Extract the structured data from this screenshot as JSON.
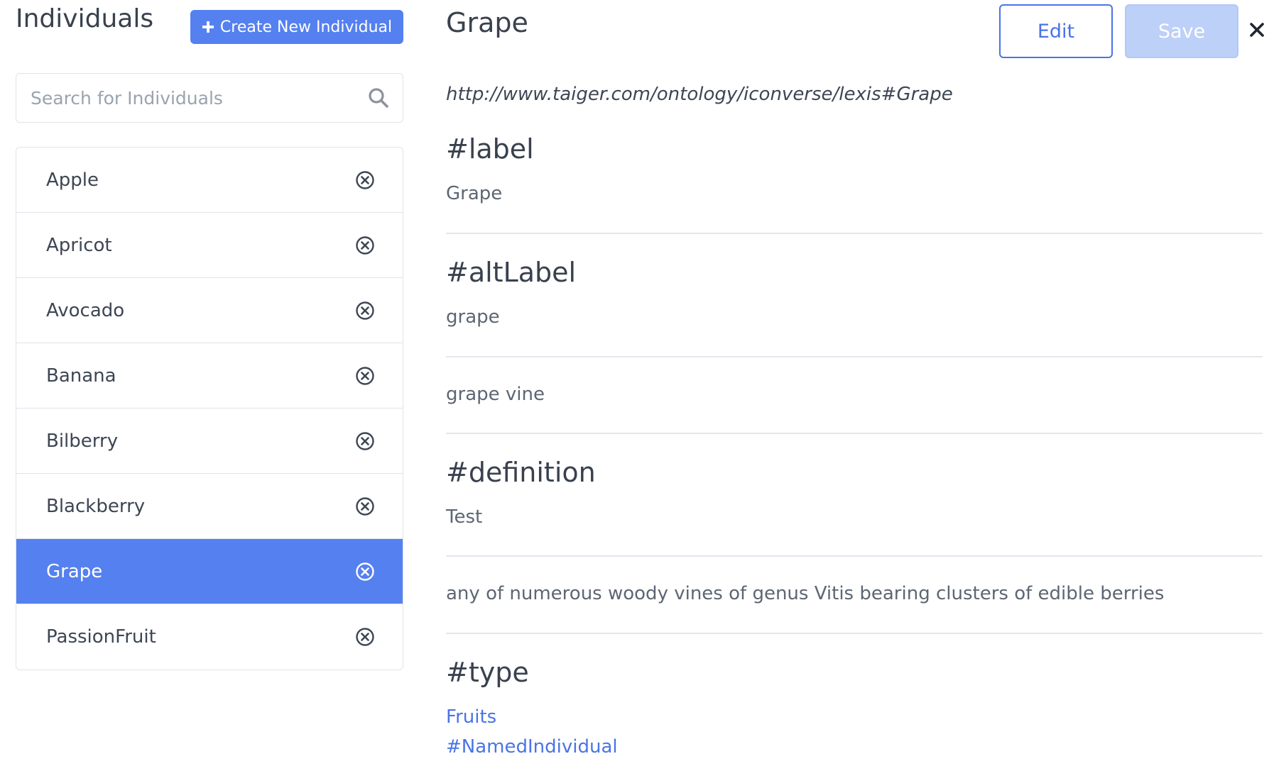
{
  "sidebar": {
    "title": "Individuals",
    "create_button": "Create New Individual",
    "search_placeholder": "Search for Individuals",
    "items": [
      {
        "label": "Apple",
        "selected": false
      },
      {
        "label": "Apricot",
        "selected": false
      },
      {
        "label": "Avocado",
        "selected": false
      },
      {
        "label": "Banana",
        "selected": false
      },
      {
        "label": "Bilberry",
        "selected": false
      },
      {
        "label": "Blackberry",
        "selected": false
      },
      {
        "label": "Grape",
        "selected": true
      },
      {
        "label": "PassionFruit",
        "selected": false
      }
    ]
  },
  "detail": {
    "title": "Grape",
    "edit_label": "Edit",
    "save_label": "Save",
    "uri": "http://www.taiger.com/ontology/iconverse/lexis#Grape",
    "sections": {
      "label": {
        "heading": "#label",
        "values": [
          "Grape"
        ]
      },
      "altLabel": {
        "heading": "#altLabel",
        "values": [
          "grape",
          "grape vine"
        ]
      },
      "definition": {
        "heading": "#definition",
        "values": [
          "Test",
          "any of numerous woody vines of genus Vitis bearing clusters of edible berries"
        ]
      },
      "type": {
        "heading": "#type",
        "values": [
          "Fruits",
          "#NamedIndividual"
        ]
      }
    }
  },
  "icons": {
    "create": "plus-icon",
    "search": "search-icon",
    "remove": "circle-x-icon",
    "close": "close-icon"
  },
  "colors": {
    "accent": "#5580f0",
    "link": "#4a74e6",
    "save_disabled": "#bcd0f8"
  }
}
